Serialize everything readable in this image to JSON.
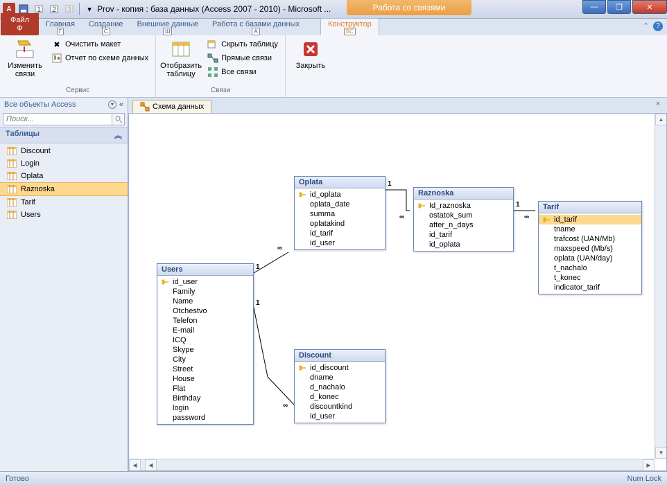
{
  "title": "Prov - копия : база данных (Access 2007 - 2010)  -  Microsoft ...",
  "context_tab": "Работа со связями",
  "tabs": {
    "file": "Файл",
    "file_key": "Ф",
    "home": "Главная",
    "home_key": "Г",
    "create": "Создание",
    "create_key": "С",
    "external": "Внешние данные",
    "external_key": "Ш",
    "dbtools": "Работа с базами данных",
    "dbtools_key": "А",
    "design": "Конструктор",
    "design_key": "БС"
  },
  "ribbon": {
    "edit_rel": "Изменить связи",
    "clear_layout": "Очистить макет",
    "rel_report": "Отчет по схеме данных",
    "group_service": "Сервис",
    "show_table": "Отобразить таблицу",
    "hide_table": "Скрыть таблицу",
    "direct_rel": "Прямые связи",
    "all_rel": "Все связи",
    "group_rel": "Связи",
    "close": "Закрыть"
  },
  "nav": {
    "header": "Все объекты Access",
    "search_ph": "Поиск...",
    "cat": "Таблицы",
    "items": [
      "Discount",
      "Login",
      "Oplata",
      "Raznoska",
      "Tarif",
      "Users"
    ],
    "selected": "Raznoska"
  },
  "doc_tab": "Схема данных",
  "tables": {
    "users": {
      "title": "Users",
      "fields": [
        "id_user",
        "Family",
        "Name",
        "Otchestvo",
        "Telefon",
        "E-mail",
        "ICQ",
        "Skype",
        "City",
        "Street",
        "House",
        "Flat",
        "Birthday",
        "login",
        "password"
      ],
      "pk": 0
    },
    "oplata": {
      "title": "Oplata",
      "fields": [
        "id_oplata",
        "oplata_date",
        "summa",
        "oplatakind",
        "id_tarif",
        "id_user"
      ],
      "pk": 0
    },
    "discount": {
      "title": "Discount",
      "fields": [
        "id_discount",
        "dname",
        "d_nachalo",
        "d_konec",
        "discountkind",
        "id_user"
      ],
      "pk": 0
    },
    "raznoska": {
      "title": "Raznoska",
      "fields": [
        "Id_raznoska",
        "ostatok_sum",
        "after_n_days",
        "id_tarif",
        "id_oplata"
      ],
      "pk": 0
    },
    "tarif": {
      "title": "Tarif",
      "fields": [
        "id_tarif",
        "tname",
        "trafcost (UAN/Mb)",
        "maxspeed (Mb/s)",
        "oplata (UAN/day)",
        "t_nachalo",
        "t_konec",
        "indicator_tarif"
      ],
      "pk": 0,
      "sel": 0
    }
  },
  "status": {
    "left": "Готово",
    "right": "Num Lock"
  }
}
